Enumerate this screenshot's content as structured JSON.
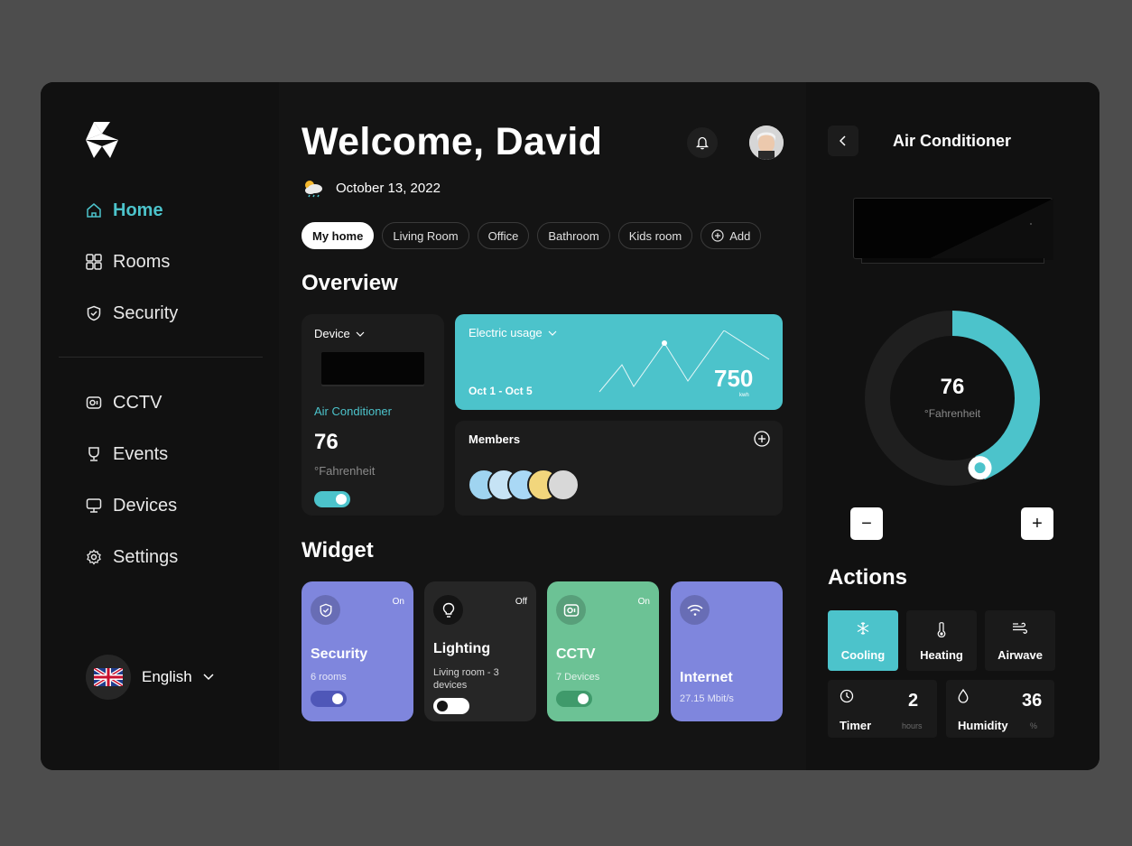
{
  "sidebar": {
    "nav_top": [
      {
        "label": "Home",
        "icon": "home-icon"
      },
      {
        "label": "Rooms",
        "icon": "grid-icon"
      },
      {
        "label": "Security",
        "icon": "shield-icon"
      }
    ],
    "nav_bottom": [
      {
        "label": "CCTV",
        "icon": "camera-icon"
      },
      {
        "label": "Events",
        "icon": "trophy-icon"
      },
      {
        "label": "Devices",
        "icon": "monitor-icon"
      },
      {
        "label": "Settings",
        "icon": "gear-icon"
      }
    ],
    "language": "English"
  },
  "header": {
    "welcome": "Welcome, David",
    "date": "October 13, 2022"
  },
  "tabs": [
    "My home",
    "Living Room",
    "Office",
    "Bathroom",
    "Kids room",
    "Add"
  ],
  "overview": {
    "title": "Overview",
    "device": {
      "label": "Device",
      "name": "Air Conditioner",
      "temp": "76",
      "unit": "°Fahrenheit",
      "on": true
    },
    "electric": {
      "label": "Electric usage",
      "range": "Oct 1 - Oct 5",
      "value": "750",
      "unit": "kwh"
    },
    "members": {
      "title": "Members",
      "count": 5
    }
  },
  "widget": {
    "title": "Widget",
    "items": [
      {
        "name": "Security",
        "status": "On",
        "sub": "6 rooms",
        "on": true,
        "bg": "#7f86dd"
      },
      {
        "name": "Lighting",
        "status": "Off",
        "sub": "Living room - 3 devices",
        "on": false,
        "bg": "#262626"
      },
      {
        "name": "CCTV",
        "status": "On",
        "sub": "7 Devices",
        "on": true,
        "bg": "#6cc295"
      },
      {
        "name": "Internet",
        "status": "",
        "sub": "27.15 Mbit/s",
        "on": null,
        "bg": "#7f86dd"
      }
    ]
  },
  "panel": {
    "title": "Air Conditioner",
    "temp": "76",
    "unit": "°Fahrenheit",
    "dial_fraction": 0.44,
    "minus": "−",
    "plus": "+",
    "actions_title": "Actions",
    "modes": [
      {
        "label": "Cooling",
        "active": true
      },
      {
        "label": "Heating",
        "active": false
      },
      {
        "label": "Airwave",
        "active": false
      }
    ],
    "timer": {
      "label": "Timer",
      "value": "2",
      "unit": "hours"
    },
    "humidity": {
      "label": "Humidity",
      "value": "36",
      "unit": "%"
    }
  },
  "colors": {
    "accent": "#4cc3cb",
    "purple": "#7f86dd",
    "green": "#6cc295"
  }
}
